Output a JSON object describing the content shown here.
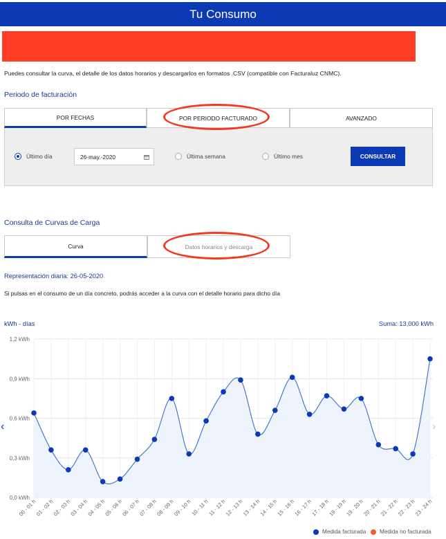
{
  "header": {
    "title": "Tu Consumo"
  },
  "intro": "Puedes consultar la curva, el detalle de los datos horarios y descargarlos en formatos .CSV (compatible con Facturaluz CNMC).",
  "billing": {
    "title": "Periodo de facturación",
    "tabs": [
      "POR FECHAS",
      "POR PERIODO FACTURADO",
      "AVANZADO"
    ],
    "radio_day": "Último día",
    "date_value": "26-may.-2020",
    "radio_week": "Última semana",
    "radio_month": "Último mes",
    "consult_label": "CONSULTAR"
  },
  "curves": {
    "title": "Consulta de Curvas de Carga",
    "tabs": [
      "Curva",
      "Datos horarios y descarga"
    ],
    "representation": "Representación diaria: 26-05-2020",
    "description": "Si pulsas en el consumo de un día concreto, podrás acceder a la curva con el detalle horario para dicho día"
  },
  "chart_labels": {
    "unit": "kWh - días",
    "sum": "Suma: 13,000 kWh"
  },
  "nav": {
    "prev": "‹",
    "next": "›"
  },
  "legend": {
    "billed": "Medida facturada",
    "not_billed": "Medida no facturada"
  },
  "colors": {
    "brand": "#0c3ab4",
    "alert": "#ff3d24",
    "not_billed": "#f2632b",
    "highlight_oval": "#f23a1e"
  },
  "chart_data": {
    "type": "line",
    "x": [
      "00 - 01 h",
      "01 - 02 h",
      "02 - 03 h",
      "03 - 04 h",
      "04 - 05 h",
      "05 - 06 h",
      "06 - 07 h",
      "07 - 08 h",
      "08 - 09 h",
      "09 - 10 h",
      "10 - 11 h",
      "11 - 12 h",
      "12 - 13 h",
      "13 - 14 h",
      "14 - 15 h",
      "15 - 16 h",
      "16 - 17 h",
      "17 - 18 h",
      "18 - 19 h",
      "19 - 20 h",
      "20 - 21 h",
      "21 - 22 h",
      "22 - 23 h",
      "23 - 24 h"
    ],
    "series": [
      {
        "name": "Medida facturada",
        "values": [
          0.64,
          0.36,
          0.21,
          0.36,
          0.12,
          0.14,
          0.29,
          0.44,
          0.75,
          0.33,
          0.58,
          0.8,
          0.89,
          0.48,
          0.66,
          0.91,
          0.63,
          0.77,
          0.67,
          0.75,
          0.4,
          0.37,
          0.33,
          1.05
        ]
      }
    ],
    "yticks": [
      "0,0 kWh",
      "0,3 kWh",
      "0,6 kWh",
      "0,9 kWh",
      "1,2 kWh"
    ],
    "ylim": [
      0,
      1.2
    ],
    "ylabel": "kWh - días",
    "grid": true,
    "legend_position": "bottom-right"
  }
}
